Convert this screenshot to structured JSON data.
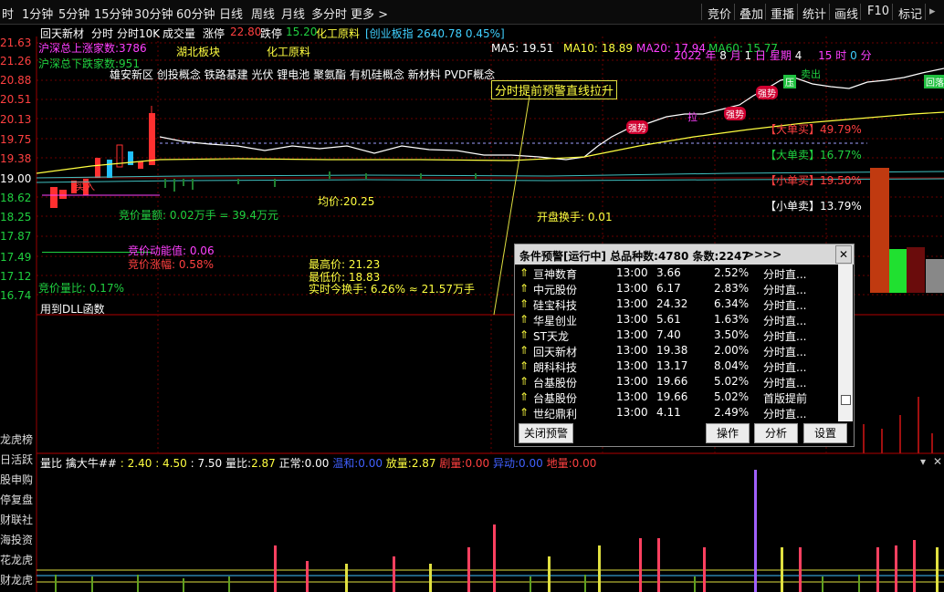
{
  "topbar": {
    "timeframes": [
      "时",
      "1分钟",
      "5分钟",
      "15分钟",
      "30分钟",
      "60分钟",
      "日线",
      "周线",
      "月线",
      "多分时",
      "更多 >"
    ],
    "tools": [
      "竞价",
      "叠加",
      "重播",
      "统计",
      "画线",
      "F10",
      "标记"
    ]
  },
  "header": {
    "stock_name": "回天新材",
    "mode": "分时",
    "mode2": "分时10K",
    "volume_label": "成交量",
    "zt_label": "涨停",
    "zt_value": "22.80",
    "dt_label": "跌停",
    "dt_value": "15.20",
    "sector": "化工原料",
    "index_text": "[创业板指 2640.78 0.45%]"
  },
  "ma": {
    "ma5": "MA5: 19.51",
    "ma10": "MA10: 18.89",
    "ma20": "MA20: 17.94",
    "ma60": "MA60: 15.77"
  },
  "date_line": {
    "year": "2022",
    "y": "年",
    "month": "8",
    "m": "月",
    "day": "1",
    "d": "日",
    "weekday": "星期",
    "wd": "4",
    "hour": "15",
    "h": "时",
    "min": "0",
    "mi": "分"
  },
  "price_labels": [
    "21.63",
    "21.26",
    "20.88",
    "20.51",
    "20.13",
    "19.75",
    "19.38",
    "19.00",
    "18.62",
    "18.25",
    "17.87",
    "17.49",
    "17.12",
    "16.74"
  ],
  "overlay": {
    "up_count": "沪深总上涨家数:3786",
    "down_count": "沪深总下跌家数:951",
    "block1": "湖北板块",
    "block2": "化工原料",
    "concepts": "雄安新区 创投概念 铁路基建 光伏 锂电池 聚氨酯 有机硅概念 新材料 PVDF概念",
    "warn_title": "分时提前预警直线拉升",
    "auction_amount": "竞价量额: 0.02万手 = 39.4万元",
    "avg_price": "均价:20.25",
    "open_turnover": "开盘换手: 0.01",
    "momentum": "竞价动能值: 0.06",
    "auction_pct": "竞价涨幅: 0.58%",
    "high": "最高价: 21.23",
    "low": "最低价: 18.83",
    "turnover": "实时今换手: 6.26% ≈ 21.57万手",
    "vol_ratio": "竞价量比: 0.17%",
    "dll": "用到DLL函数",
    "buy_label": "买入",
    "tags": [
      "强势",
      "拉",
      "强势",
      "强势"
    ],
    "big_buy": "【大单买】49.79%",
    "big_sell": "【大单卖】16.77%",
    "small_buy": "【小单买】19.50%",
    "small_sell": "【小单卖】13.79%",
    "sell_tag": "卖出",
    "press_tag": "压",
    "back_tag": "回落"
  },
  "popup": {
    "title": "条件预警[运行中] 总品种数:4780 条数:2247",
    "arrows": ">>>>",
    "rows": [
      {
        "name": "亘神数育",
        "time": "13:00",
        "price": "3.66",
        "pct": "2.52%",
        "type": "分时直..."
      },
      {
        "name": "中元股份",
        "time": "13:00",
        "price": "6.17",
        "pct": "2.83%",
        "type": "分时直..."
      },
      {
        "name": "硅宝科技",
        "time": "13:00",
        "price": "24.32",
        "pct": "6.34%",
        "type": "分时直..."
      },
      {
        "name": "华星创业",
        "time": "13:00",
        "price": "5.61",
        "pct": "1.63%",
        "type": "分时直..."
      },
      {
        "name": "ST天龙",
        "time": "13:00",
        "price": "7.40",
        "pct": "3.50%",
        "type": "分时直..."
      },
      {
        "name": "回天新材",
        "time": "13:00",
        "price": "19.38",
        "pct": "2.00%",
        "type": "分时直..."
      },
      {
        "name": "朗科科技",
        "time": "13:00",
        "price": "13.17",
        "pct": "8.04%",
        "type": "分时直..."
      },
      {
        "name": "台基股份",
        "time": "13:00",
        "price": "19.66",
        "pct": "5.02%",
        "type": "分时直..."
      },
      {
        "name": "台基股份",
        "time": "13:00",
        "price": "19.66",
        "pct": "5.02%",
        "type": "首版提前"
      },
      {
        "name": "世纪鼎利",
        "time": "13:00",
        "price": "4.11",
        "pct": "2.49%",
        "type": "分时直..."
      }
    ],
    "close_btn": "关闭预警",
    "op_btn": "操作",
    "an_btn": "分析",
    "set_btn": "设置"
  },
  "left_menu": [
    "龙虎榜",
    "日活跃",
    "股申购",
    "停复盘",
    "财联社",
    "海投资",
    "花龙虎",
    "财龙虎"
  ],
  "indicator": {
    "name": "量比",
    "formula": "擒大牛##",
    "v1": ": 2.40",
    "v2": ": 4.50",
    "v3": ": 7.50",
    "lb_label": "量比:",
    "lb_val": "2.87",
    "zc_label": "正常:",
    "zc_val": "0.00",
    "wh_label": "温和:",
    "wh_val": "0.00",
    "fl_label": "放量:",
    "fl_val": "2.87",
    "jl_label": "剧量:",
    "jl_val": "0.00",
    "yd_label": "异动:",
    "yd_val": "0.00",
    "dl_label": "地量:",
    "dl_val": "0.00"
  },
  "colors": {
    "up": "#ff4040",
    "down": "#20d040",
    "avg": "#ffff40",
    "price": "#ffffff"
  }
}
